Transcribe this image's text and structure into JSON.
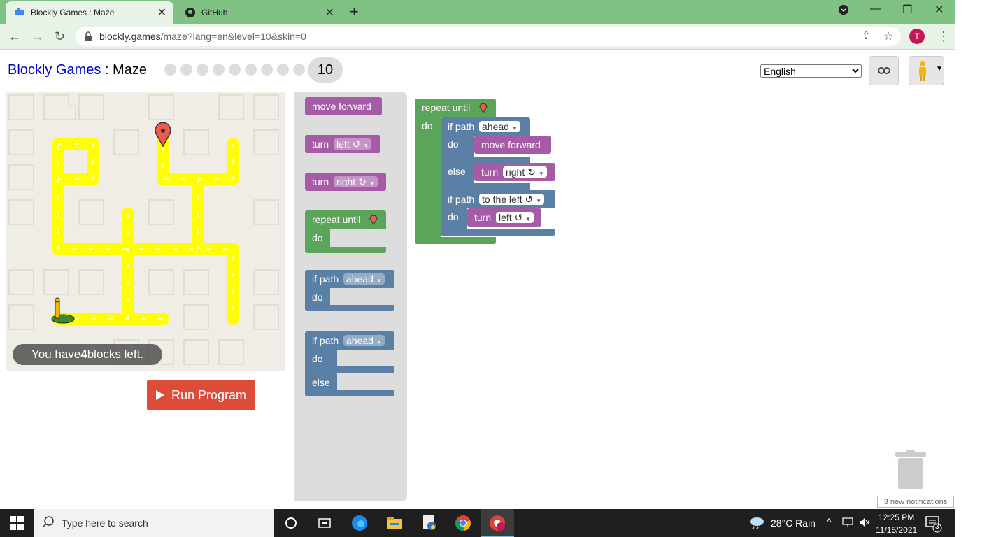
{
  "browser": {
    "tabs": [
      {
        "title": "Blockly Games : Maze",
        "active": true
      },
      {
        "title": "GitHub",
        "active": false
      }
    ],
    "url": {
      "host": "blockly.games",
      "path": "/maze?lang=en&level=10&skin=0"
    },
    "profile_initial": "T"
  },
  "header": {
    "brand": "Blockly Games",
    "separator": " : ",
    "game": "Maze",
    "current_level": "10",
    "completed_levels": 9,
    "language": "English"
  },
  "maze": {
    "blocks_left_prefix": "You have ",
    "blocks_left_count": "4",
    "blocks_left_suffix": " blocks left.",
    "run_label": "Run Program"
  },
  "toolbox": {
    "move_forward": "move forward",
    "turn": "turn",
    "left": "left ↺",
    "right": "right ↻",
    "repeat_until": "repeat until",
    "do": "do",
    "if_path": "if path",
    "ahead": "ahead",
    "else": "else"
  },
  "program": {
    "repeat_until": "repeat until",
    "do": "do",
    "if1_label": "if path",
    "if1_dir": "ahead",
    "if1_do": "do",
    "if1_action": "move forward",
    "if1_else": "else",
    "if1_else_turn": "turn",
    "if1_else_dir": "right ↻",
    "if2_label": "if path",
    "if2_dir": "to the left ↺",
    "if2_do": "do",
    "if2_turn": "turn",
    "if2_turn_dir": "left ↺"
  },
  "taskbar": {
    "search_placeholder": "Type here to search",
    "weather": "28°C  Rain",
    "time": "12:25 PM",
    "date": "11/15/2021",
    "notification_tooltip": "3 new notifications",
    "notification_count": "3"
  },
  "colors": {
    "motion": "#a55ba5",
    "loop": "#5ba55b",
    "logic": "#5b80a5",
    "path": "#ffff00",
    "run": "#dd4b39"
  }
}
